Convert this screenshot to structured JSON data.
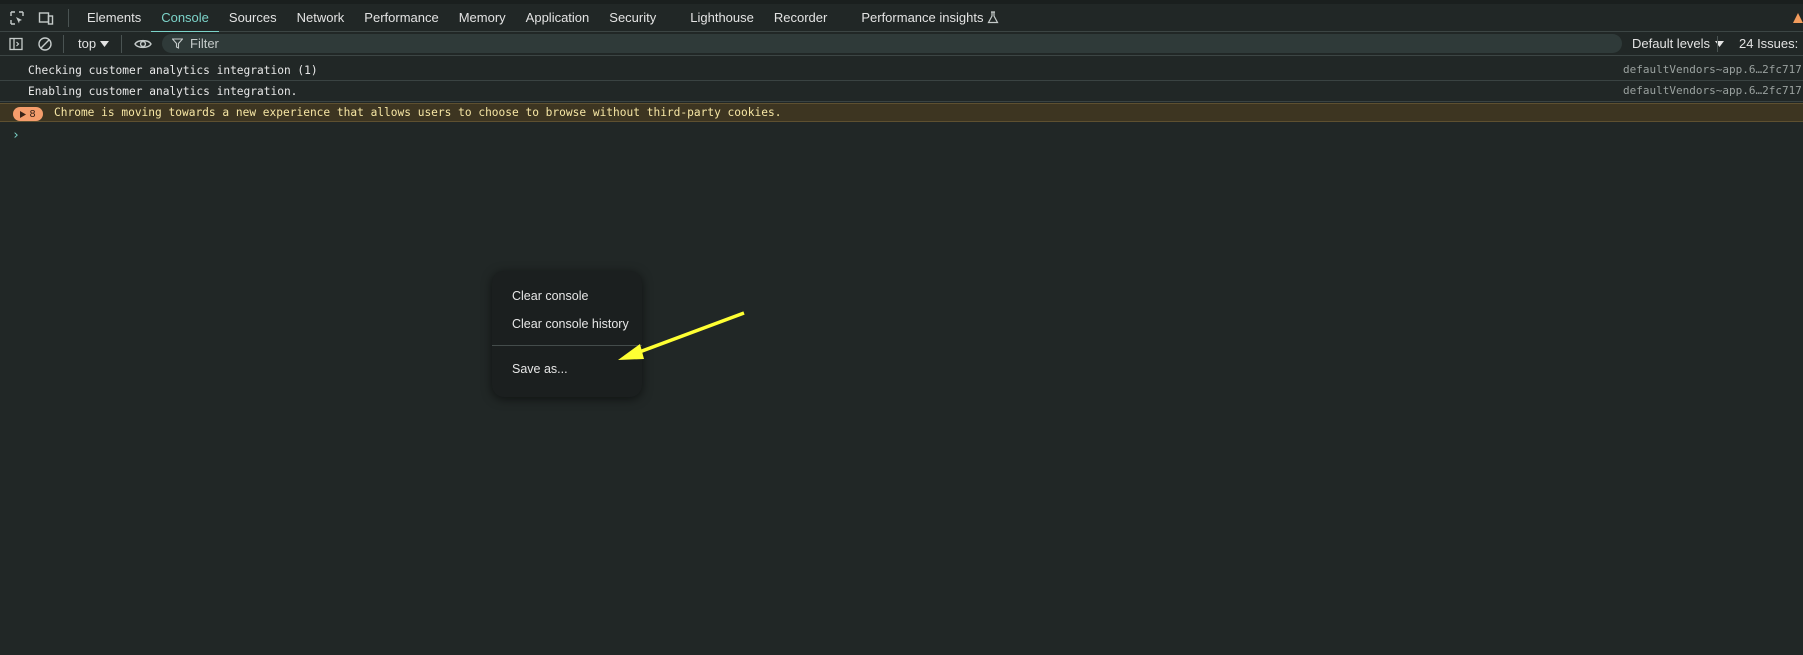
{
  "tabs": [
    {
      "label": "Elements"
    },
    {
      "label": "Console",
      "active": true
    },
    {
      "label": "Sources"
    },
    {
      "label": "Network"
    },
    {
      "label": "Performance"
    },
    {
      "label": "Memory"
    },
    {
      "label": "Application"
    },
    {
      "label": "Security"
    },
    {
      "label": "Lighthouse"
    },
    {
      "label": "Recorder"
    },
    {
      "label": "Performance insights"
    }
  ],
  "toolbar": {
    "context": "top",
    "filter_placeholder": "Filter",
    "levels": "Default levels",
    "issues": "24 Issues:"
  },
  "console": {
    "messages": [
      {
        "text": "Checking customer analytics integration (1)",
        "source": "defaultVendors~app.6…2fc717"
      },
      {
        "text": "Enabling customer analytics integration.",
        "source": "defaultVendors~app.6…2fc717"
      }
    ],
    "warning": {
      "count": "8",
      "text": "Chrome is moving towards a new experience that allows users to choose to browse without third-party cookies."
    },
    "prompt": "›"
  },
  "context_menu": {
    "items": [
      {
        "label": "Clear console"
      },
      {
        "label": "Clear console history"
      },
      {
        "label": "Save as..."
      }
    ]
  },
  "colors": {
    "accent": "#7cd3c9",
    "background": "#212726",
    "warning_bg": "#3d3521",
    "annotation_arrow": "#ffff33"
  }
}
